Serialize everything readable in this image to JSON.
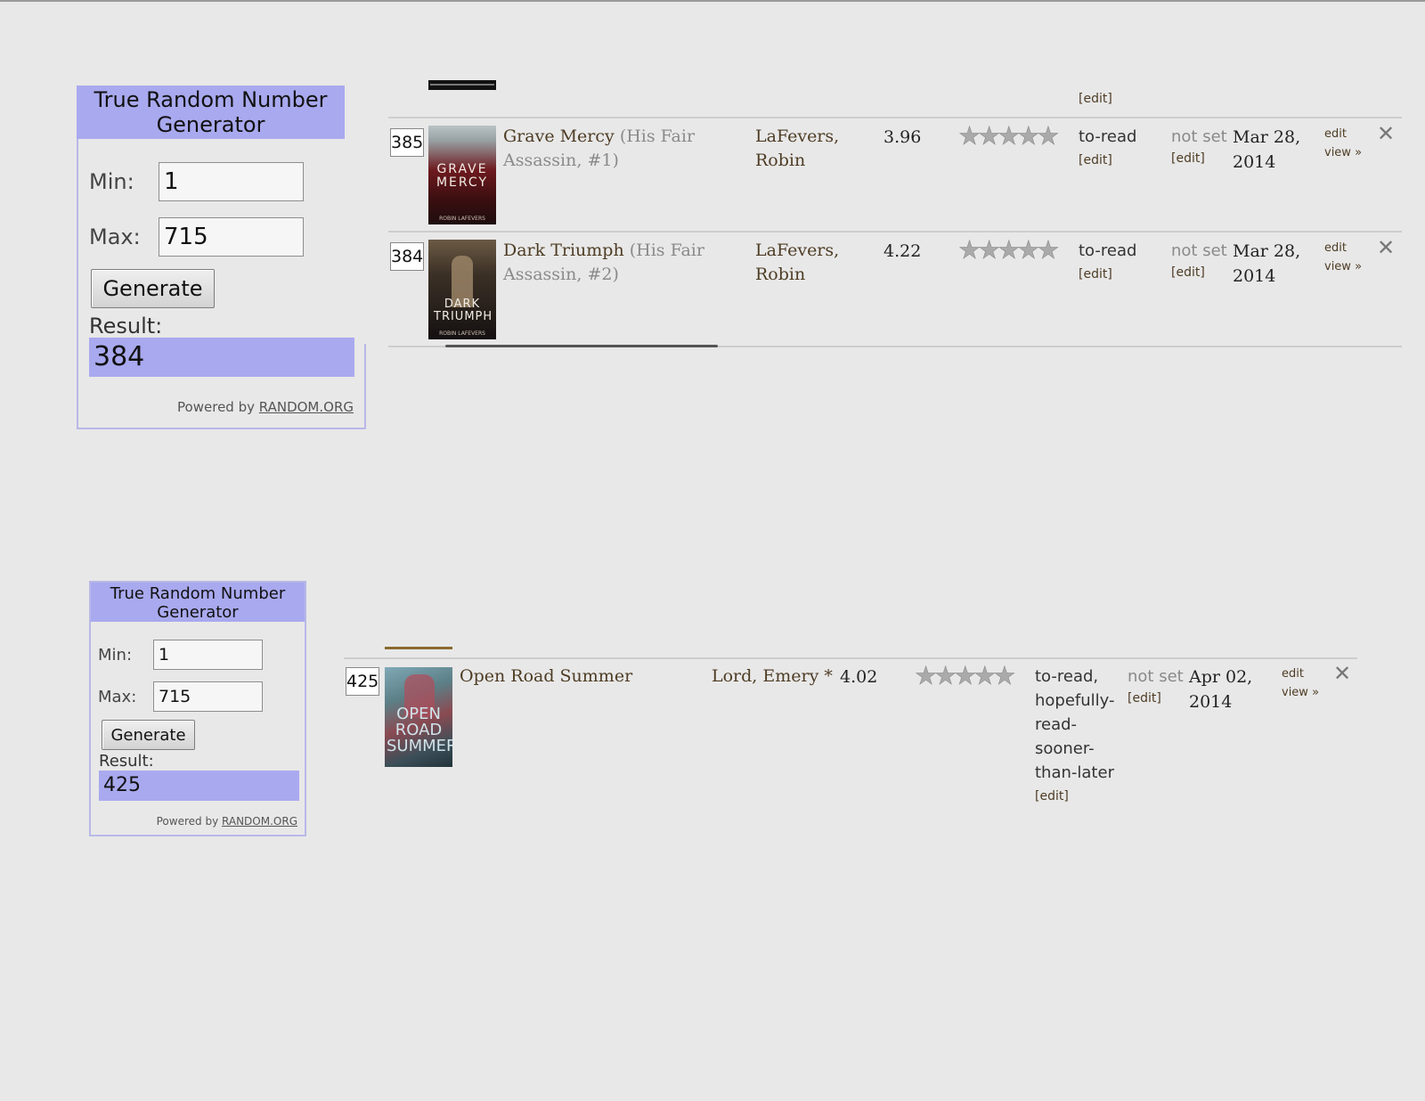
{
  "rng_top": {
    "title": "True Random Number Generator",
    "min_label": "Min:",
    "min_value": "1",
    "max_label": "Max:",
    "max_value": "715",
    "generate_label": "Generate",
    "result_label": "Result:",
    "result_value": "384",
    "powered_by": "Powered by",
    "powered_link": "RANDOM.ORG"
  },
  "rng_bottom": {
    "title": "True Random Number Generator",
    "min_label": "Min:",
    "min_value": "1",
    "max_label": "Max:",
    "max_value": "715",
    "generate_label": "Generate",
    "result_label": "Result:",
    "result_value": "425",
    "powered_by": "Powered by",
    "powered_link": "RANDOM.ORG"
  },
  "shelf_top": {
    "header_edit": "[edit]",
    "books": [
      {
        "number": "385",
        "cover_text": "GRAVE MERCY",
        "cover_author": "ROBIN LAFEVERS",
        "title": "Grave Mercy",
        "series": "(His Fair Assassin, #1)",
        "author": "LaFevers, Robin",
        "avg_rating": "3.96",
        "stars": "★★★★★",
        "shelf": "to-read",
        "shelf_edit": "[edit]",
        "date_read": "not set",
        "date_read_edit": "[edit]",
        "date_added": "Mar 28, 2014",
        "edit_label": "edit",
        "view_label": "view »",
        "remove_icon": "✕"
      },
      {
        "number": "384",
        "cover_text": "DARK TRIUMPH",
        "cover_author": "ROBIN LAFEVERS",
        "title": "Dark Triumph",
        "series": "(His Fair Assassin, #2)",
        "author": "LaFevers, Robin",
        "avg_rating": "4.22",
        "stars": "★★★★★",
        "shelf": "to-read",
        "shelf_edit": "[edit]",
        "date_read": "not set",
        "date_read_edit": "[edit]",
        "date_added": "Mar 28, 2014",
        "edit_label": "edit",
        "view_label": "view »",
        "remove_icon": "✕"
      }
    ]
  },
  "shelf_bottom": {
    "book": {
      "number": "425",
      "cover_text": "OPEN ROAD SUMMER",
      "title": "Open Road Summer",
      "author": "Lord, Emery *",
      "avg_rating": "4.02",
      "stars": "★★★★★",
      "shelf": "to-read, hopefully-read-sooner-than-later",
      "shelf_edit": "[edit]",
      "date_read": "not set",
      "date_read_edit": "[edit]",
      "date_added": "Apr 02, 2014",
      "edit_label": "edit",
      "view_label": "view »",
      "remove_icon": "✕"
    }
  },
  "colors": {
    "rng_accent": "#a9a9ef",
    "link_brown": "#4e3c24",
    "background": "#e8e8e8"
  }
}
